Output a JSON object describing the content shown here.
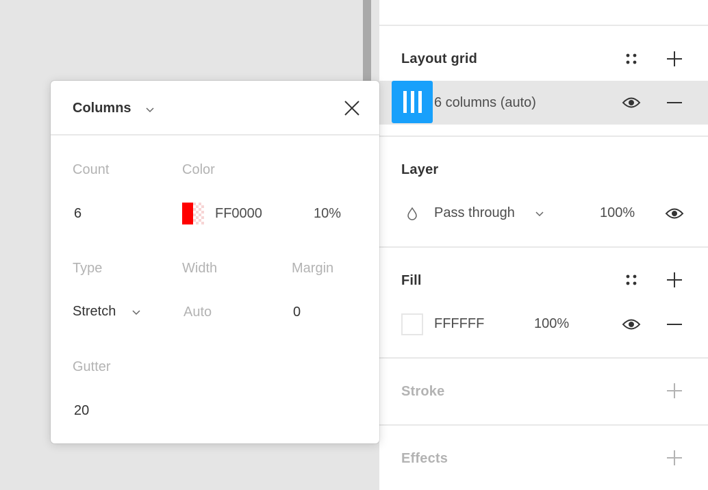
{
  "panel": {
    "layout_grid": {
      "title": "Layout grid",
      "grid_item": {
        "label": "6 columns (auto)"
      }
    },
    "layer": {
      "title": "Layer",
      "blend_mode": "Pass through",
      "opacity": "100%"
    },
    "fill": {
      "title": "Fill",
      "hex": "FFFFFF",
      "opacity": "100%",
      "swatch_color": "#FFFFFF"
    },
    "stroke": {
      "title": "Stroke"
    },
    "effects": {
      "title": "Effects"
    }
  },
  "popover": {
    "type_label": "Columns",
    "count_label": "Count",
    "count_value": "6",
    "color_label": "Color",
    "color_hex": "FF0000",
    "color_opacity": "10%",
    "swatch_color": "#FF0000",
    "type_field_label": "Type",
    "type_value": "Stretch",
    "width_label": "Width",
    "width_value": "Auto",
    "margin_label": "Margin",
    "margin_value": "0",
    "gutter_label": "Gutter",
    "gutter_value": "20"
  },
  "colors": {
    "accent": "#18A0FB",
    "canvas": "#E5E5E5",
    "selected_row": "#E6E6E6"
  },
  "icons": {
    "style": "style-dots-icon",
    "add": "plus-icon",
    "remove": "minus-icon",
    "visibility": "eye-icon",
    "close": "close-icon",
    "chevron": "chevron-down-icon",
    "blend": "drop-icon",
    "grid": "columns-grid-icon"
  }
}
